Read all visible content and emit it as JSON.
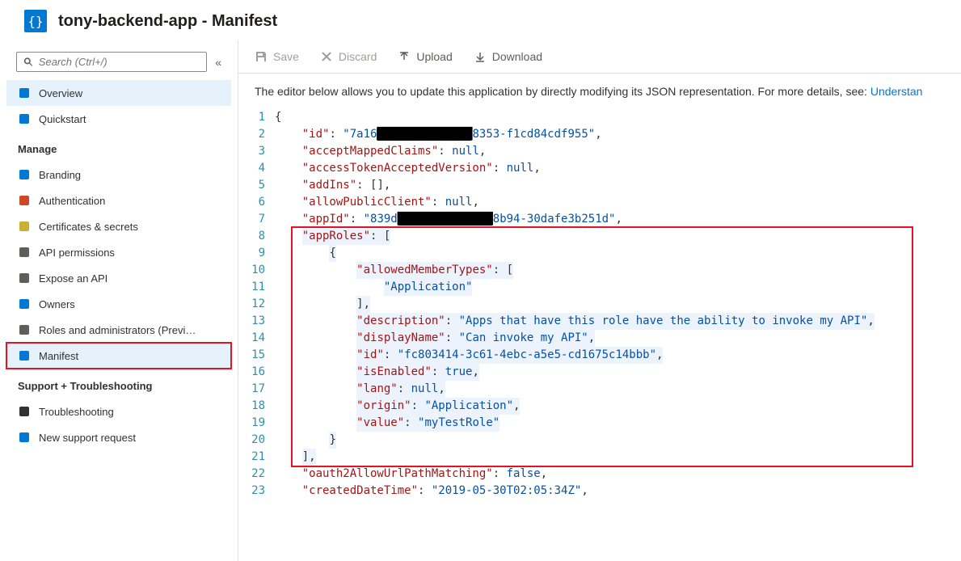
{
  "page_title": "tony-backend-app - Manifest",
  "search_placeholder": "Search (Ctrl+/)",
  "sidebar": {
    "top": [
      {
        "label": "Overview",
        "icon": "overview-icon",
        "color": "#0078d4",
        "active": true
      },
      {
        "label": "Quickstart",
        "icon": "quickstart-icon",
        "color": "#0078d4"
      }
    ],
    "manage_header": "Manage",
    "manage": [
      {
        "label": "Branding",
        "icon": "branding-icon",
        "color": "#0078d4"
      },
      {
        "label": "Authentication",
        "icon": "auth-icon",
        "color": "#d04727"
      },
      {
        "label": "Certificates & secrets",
        "icon": "cert-icon",
        "color": "#c9b037"
      },
      {
        "label": "API permissions",
        "icon": "api-perm-icon",
        "color": "#605e5c"
      },
      {
        "label": "Expose an API",
        "icon": "expose-api-icon",
        "color": "#605e5c"
      },
      {
        "label": "Owners",
        "icon": "owners-icon",
        "color": "#0078d4"
      },
      {
        "label": "Roles and administrators (Previ…",
        "icon": "roles-icon",
        "color": "#605e5c"
      },
      {
        "label": "Manifest",
        "icon": "manifest-icon",
        "color": "#0078d4",
        "selected": true
      }
    ],
    "support_header": "Support + Troubleshooting",
    "support": [
      {
        "label": "Troubleshooting",
        "icon": "troubleshoot-icon",
        "color": "#323130"
      },
      {
        "label": "New support request",
        "icon": "support-icon",
        "color": "#0078d4"
      }
    ]
  },
  "toolbar": {
    "save": "Save",
    "discard": "Discard",
    "upload": "Upload",
    "download": "Download"
  },
  "description_text": "The editor below allows you to update this application by directly modifying its JSON representation. For more details, see: ",
  "description_link": "Understan",
  "editor": {
    "lines": [
      {
        "n": 1,
        "indent": 0,
        "text": "{"
      },
      {
        "n": 2,
        "indent": 1,
        "key": "id",
        "valueParts": [
          {
            "t": "str",
            "v": "\"7a16"
          },
          {
            "t": "redact",
            "v": "██████████████"
          },
          {
            "t": "str",
            "v": "8353-f1cd84cdf955\""
          }
        ],
        "comma": true
      },
      {
        "n": 3,
        "indent": 1,
        "key": "acceptMappedClaims",
        "valueParts": [
          {
            "t": "null",
            "v": "null"
          }
        ],
        "comma": true
      },
      {
        "n": 4,
        "indent": 1,
        "key": "accessTokenAcceptedVersion",
        "valueParts": [
          {
            "t": "null",
            "v": "null"
          }
        ],
        "comma": true
      },
      {
        "n": 5,
        "indent": 1,
        "key": "addIns",
        "valueParts": [
          {
            "t": "plain",
            "v": "[]"
          }
        ],
        "comma": true
      },
      {
        "n": 6,
        "indent": 1,
        "key": "allowPublicClient",
        "valueParts": [
          {
            "t": "null",
            "v": "null"
          }
        ],
        "comma": true
      },
      {
        "n": 7,
        "indent": 1,
        "key": "appId",
        "valueParts": [
          {
            "t": "str",
            "v": "\"839d"
          },
          {
            "t": "redact",
            "v": "██████████████"
          },
          {
            "t": "str",
            "v": "8b94-30dafe3b251d\""
          }
        ],
        "comma": true
      },
      {
        "n": 8,
        "indent": 1,
        "hl": true,
        "key": "appRoles",
        "valueParts": [
          {
            "t": "plain",
            "v": "["
          }
        ]
      },
      {
        "n": 9,
        "indent": 2,
        "hl": true,
        "text": "{"
      },
      {
        "n": 10,
        "indent": 3,
        "hl": true,
        "key": "allowedMemberTypes",
        "valueParts": [
          {
            "t": "plain",
            "v": "["
          }
        ]
      },
      {
        "n": 11,
        "indent": 4,
        "hl": true,
        "valueParts": [
          {
            "t": "str",
            "v": "\"Application\""
          }
        ]
      },
      {
        "n": 12,
        "indent": 3,
        "hl": true,
        "text": "],"
      },
      {
        "n": 13,
        "indent": 3,
        "hl": true,
        "key": "description",
        "valueParts": [
          {
            "t": "str",
            "v": "\"Apps that have this role have the ability to invoke my API\""
          }
        ],
        "comma": true
      },
      {
        "n": 14,
        "indent": 3,
        "hl": true,
        "key": "displayName",
        "valueParts": [
          {
            "t": "str",
            "v": "\"Can invoke my API\""
          }
        ],
        "comma": true
      },
      {
        "n": 15,
        "indent": 3,
        "hl": true,
        "key": "id",
        "valueParts": [
          {
            "t": "str",
            "v": "\"fc803414-3c61-4ebc-a5e5-cd1675c14bbb\""
          }
        ],
        "comma": true
      },
      {
        "n": 16,
        "indent": 3,
        "hl": true,
        "key": "isEnabled",
        "valueParts": [
          {
            "t": "bool",
            "v": "true"
          }
        ],
        "comma": true
      },
      {
        "n": 17,
        "indent": 3,
        "hl": true,
        "key": "lang",
        "valueParts": [
          {
            "t": "null",
            "v": "null"
          }
        ],
        "comma": true
      },
      {
        "n": 18,
        "indent": 3,
        "hl": true,
        "key": "origin",
        "valueParts": [
          {
            "t": "str",
            "v": "\"Application\""
          }
        ],
        "comma": true
      },
      {
        "n": 19,
        "indent": 3,
        "hl": true,
        "key": "value",
        "valueParts": [
          {
            "t": "str",
            "v": "\"myTestRole\""
          }
        ]
      },
      {
        "n": 20,
        "indent": 2,
        "hl": true,
        "text": "}"
      },
      {
        "n": 21,
        "indent": 1,
        "hl": true,
        "text": "],"
      },
      {
        "n": 22,
        "indent": 1,
        "key": "oauth2AllowUrlPathMatching",
        "valueParts": [
          {
            "t": "bool",
            "v": "false"
          }
        ],
        "comma": true
      },
      {
        "n": 23,
        "indent": 1,
        "key": "createdDateTime",
        "valueParts": [
          {
            "t": "str",
            "v": "\"2019-05-30T02:05:34Z\""
          }
        ],
        "comma": true
      }
    ],
    "highlight_box_lines": [
      8,
      21
    ]
  }
}
